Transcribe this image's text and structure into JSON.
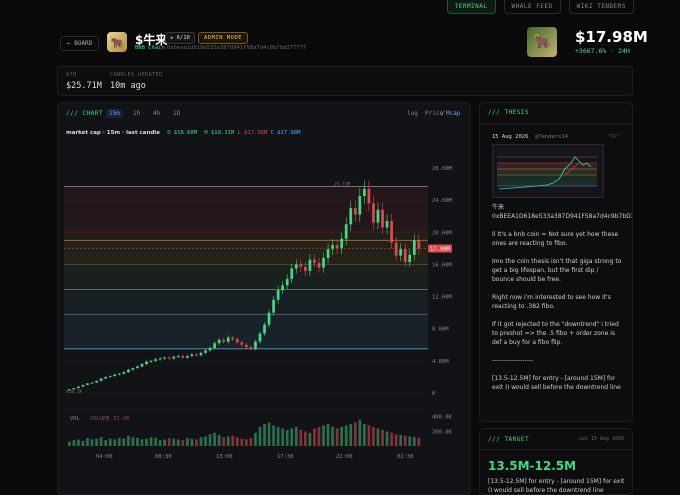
{
  "nav": {
    "tabs": [
      "TERMINAL",
      "WHALE FEED",
      "WIKI TENDERS"
    ],
    "active": "TERMINAL"
  },
  "header": {
    "back_label": "← BOARD",
    "token_name": "$牛来",
    "score": "★ 6/10",
    "admin_badge": "ADMIN MODE",
    "chain": "BNB Chain",
    "address": "0xbeea1d618e533a387d941f58a7d4c9b7bd377777",
    "market_cap": "$17.98M",
    "change": "+3667.6% · 24H"
  },
  "stats": [
    {
      "label": "ATH",
      "value": "$25.71M"
    },
    {
      "label": "CANDLES UPDATED",
      "value": "10m ago"
    }
  ],
  "chart_panel": {
    "heading": "/// CHART",
    "timeframes": [
      "15m",
      "1h",
      "4h",
      "1D"
    ],
    "active_timeframe": "15m",
    "right_toggles": [
      "log",
      "Price",
      "/",
      "Mcap"
    ],
    "legend_title": "market cap · 15m · last candle",
    "legend_o": "O $18.68M",
    "legend_h": "H $19.11M",
    "legend_l": "L $17.56M",
    "legend_c": "C $17.98M",
    "volume_label": "VOL",
    "volume_value": "VOLUME 31.6K",
    "ath_marker": "25.71M",
    "low_marker": "458.1K",
    "last_price_tag": "17.98M"
  },
  "chart_data": {
    "type": "candlestick",
    "y_axis": [
      "28.00M",
      "24.00M",
      "20.00M",
      "16.00M",
      "12.00M",
      "8.00M",
      "4.00M",
      "0"
    ],
    "y_range": [
      0,
      28
    ],
    "x_axis": [
      "04:00",
      "08:30",
      "13:00",
      "17:30",
      "22:00",
      "02:30"
    ],
    "volume_axis": [
      "400.0K",
      "200.0K"
    ],
    "fib_levels_m": [
      25.71,
      20.0,
      19.0,
      16.0,
      12.9,
      9.8,
      5.5
    ],
    "fib_colors": [
      "#aaaaaa",
      "#e0484d",
      "#c8843a",
      "#d9b13a",
      "#6aa66a",
      "#5a8e8e",
      "#5ab8d9"
    ],
    "close_series_m": [
      0.46,
      0.6,
      0.8,
      1.0,
      1.2,
      1.3,
      1.5,
      1.8,
      2.0,
      2.1,
      2.3,
      2.4,
      2.6,
      2.9,
      3.1,
      3.3,
      3.6,
      3.9,
      4.0,
      4.2,
      4.3,
      4.4,
      4.3,
      4.5,
      4.6,
      4.4,
      4.6,
      4.8,
      4.7,
      5.0,
      5.3,
      5.6,
      6.2,
      6.6,
      6.4,
      6.9,
      6.7,
      6.3,
      6.0,
      5.7,
      5.5,
      6.4,
      7.4,
      8.5,
      10.0,
      11.6,
      12.8,
      13.4,
      14.2,
      15.5,
      16.0,
      15.7,
      15.2,
      16.6,
      16.2,
      15.6,
      16.8,
      17.9,
      18.4,
      18.0,
      19.2,
      21.0,
      23.0,
      22.2,
      24.5,
      25.4,
      23.6,
      21.2,
      22.8,
      20.6,
      21.4,
      18.7,
      17.1,
      17.9,
      16.3,
      17.2,
      19.0,
      17.98
    ],
    "volume_k": [
      60,
      80,
      90,
      70,
      110,
      90,
      100,
      120,
      80,
      100,
      90,
      110,
      100,
      140,
      120,
      110,
      90,
      100,
      120,
      110,
      80,
      90,
      110,
      100,
      90,
      80,
      110,
      100,
      90,
      120,
      130,
      160,
      180,
      150,
      120,
      130,
      140,
      120,
      100,
      90,
      110,
      180,
      260,
      300,
      320,
      280,
      260,
      240,
      220,
      240,
      260,
      220,
      200,
      180,
      240,
      260,
      280,
      300,
      260,
      240,
      260,
      280,
      300,
      320,
      360,
      300,
      280,
      260,
      240,
      220,
      200,
      180,
      160,
      150,
      140,
      130,
      120,
      110
    ]
  },
  "thesis": {
    "heading": "/// THESIS",
    "post_date": "15 Aug 2026",
    "post_user": "@Tenders14",
    "post_mark": "\"87\"",
    "body": "牛来\n0xBEEA1D618e533a387D941F58a7d4c9b7bD377777\n\nIl It's a bnb coin = Not sure yet how these ones are reacting to fibo.\n\nImo the coin thesis isn't that giga strong to get a big lifespan, but the first dip / bounce should be free.\n\nRight now i'm interested to see how it's reacting to .382 fibo.\n\nIf it got rejected to the \"downtrend\" i tried to preshot => the .5 fibo + order zone is def a buy for a fibo flip.\n\n-------------------\n\n[13.5-12.5M] for entry - [around 15M] for exit (I would sell before the downtrend line"
  },
  "target": {
    "heading": "/// TARGET",
    "date": "sat 15 Aug 2026",
    "range": "13.5M-12.5M",
    "text": "[13.5-12.5M] for entry - [around 15M] for exit (I would sell before the downtrend line"
  }
}
